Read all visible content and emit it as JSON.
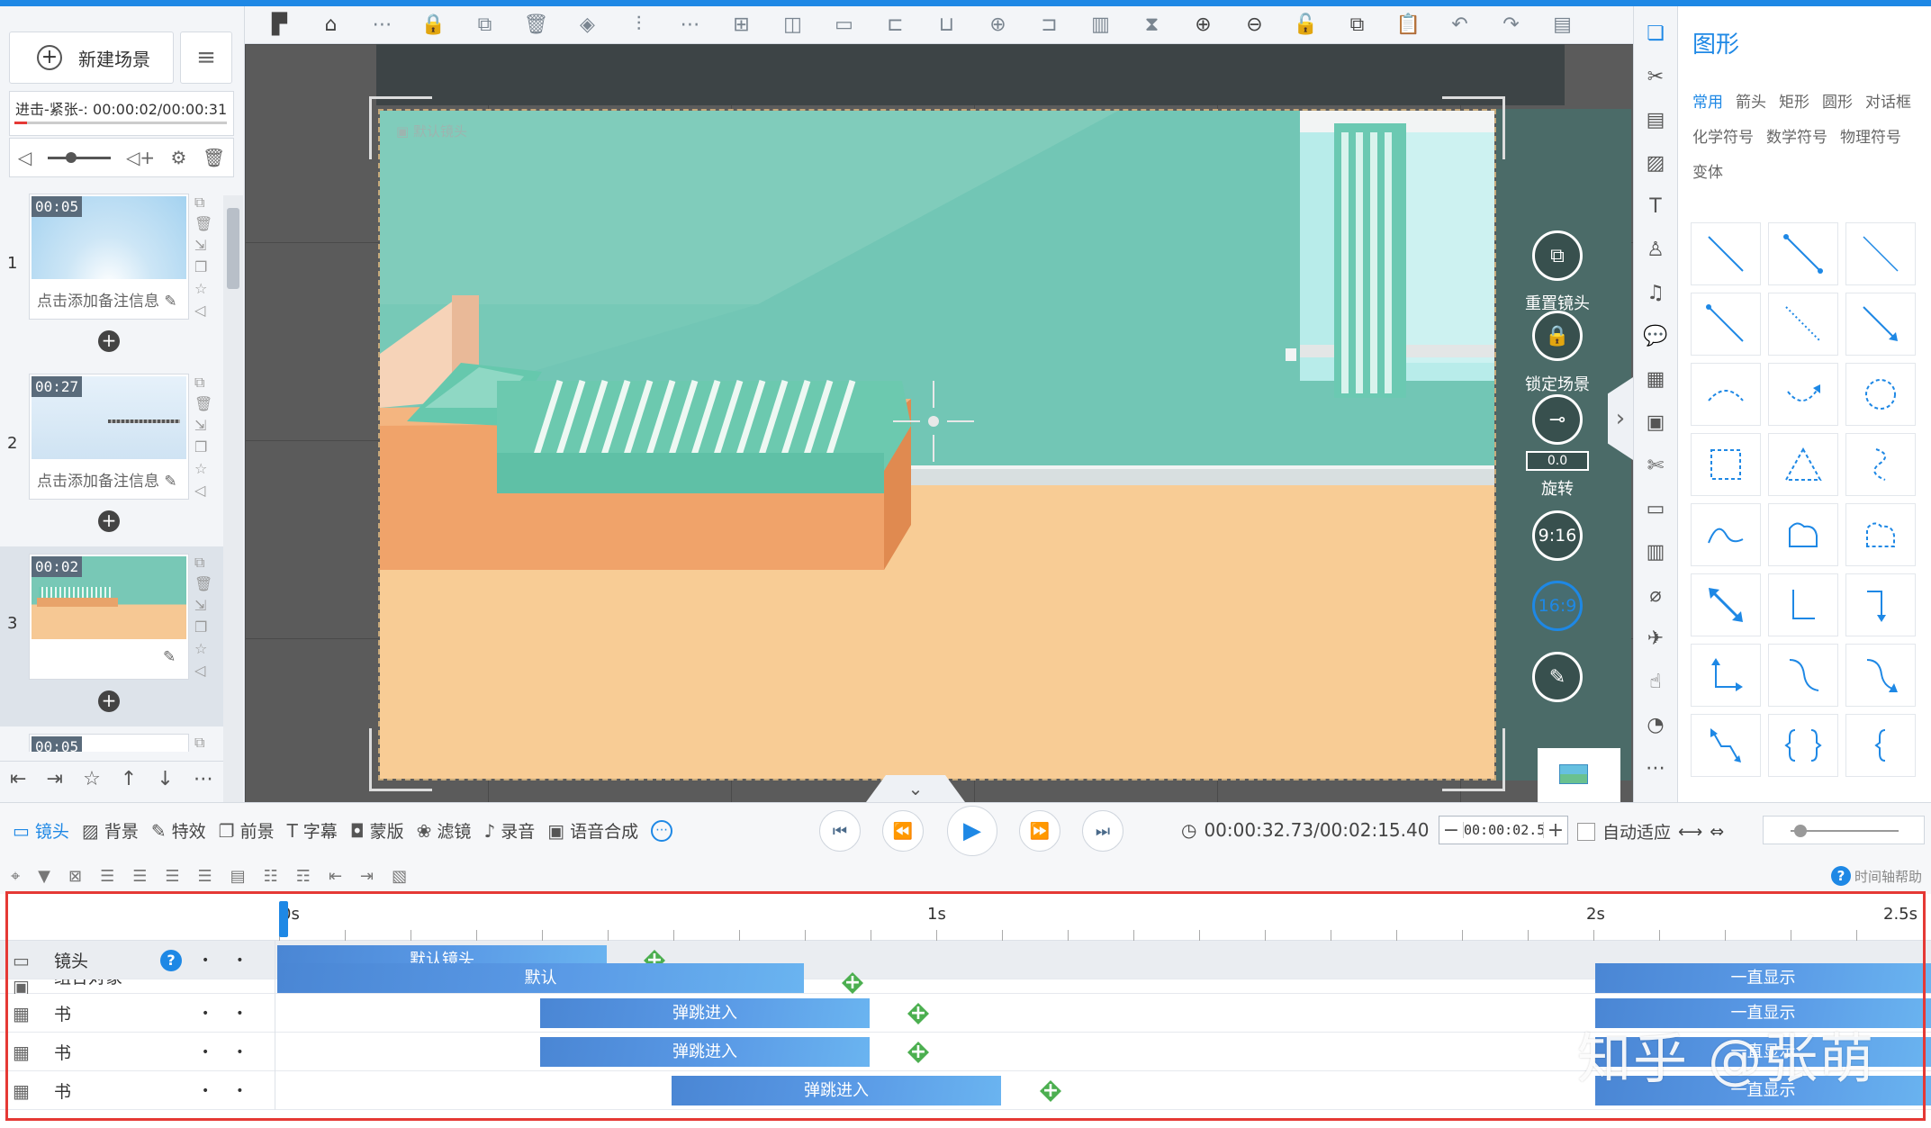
{
  "left": {
    "new_scene_label": "新建场景",
    "scene_info": "进击-紧张-: 00:00:02/00:00:31",
    "scenes": [
      {
        "num": "1",
        "duration": "00:05",
        "note": "点击添加备注信息"
      },
      {
        "num": "2",
        "duration": "00:27",
        "note": "点击添加备注信息"
      },
      {
        "num": "3",
        "duration": "00:02",
        "note": ""
      },
      {
        "num": "",
        "duration": "00:05",
        "note": ""
      }
    ]
  },
  "stage": {
    "camera_label": "默认镜头",
    "reset_camera": "重置镜头",
    "lock_scene": "锁定场景",
    "rotation_value": "0.0",
    "rotate": "旋转",
    "ratio_916": "9:16",
    "ratio_169": "16:9"
  },
  "shapes": {
    "title": "图形",
    "categories": [
      "常用",
      "箭头",
      "矩形",
      "圆形",
      "对话框",
      "化学符号",
      "数学符号",
      "物理符号",
      "变体"
    ],
    "active_category": "常用"
  },
  "midbar": {
    "tabs": [
      "镜头",
      "背景",
      "特效",
      "前景",
      "字幕",
      "蒙版",
      "滤镜",
      "录音",
      "语音合成"
    ],
    "time": "00:00:32.73/00:02:15.40",
    "stepper_value": "00:00:02.5",
    "autofit_label": "自动适应"
  },
  "timeline": {
    "help_label": "时间轴帮助",
    "ruler_labels": [
      "0s",
      "1s",
      "2s",
      "2.5s"
    ],
    "rows": [
      {
        "label": "镜头",
        "bar": "默认镜头"
      },
      {
        "label": "组合对象",
        "bar": "默认",
        "bar2": "一直显示"
      },
      {
        "label": "书",
        "bar": "弹跳进入",
        "bar2": "一直显示"
      },
      {
        "label": "书",
        "bar": "弹跳进入",
        "bar2": "一直显示"
      },
      {
        "label": "书",
        "bar": "弹跳进入",
        "bar2": "一直显示"
      }
    ]
  },
  "watermark": "知乎 @张萌",
  "colors": {
    "accent": "#1e88e5",
    "highlight_box": "#e53935",
    "keyframe": "#4caf50"
  }
}
